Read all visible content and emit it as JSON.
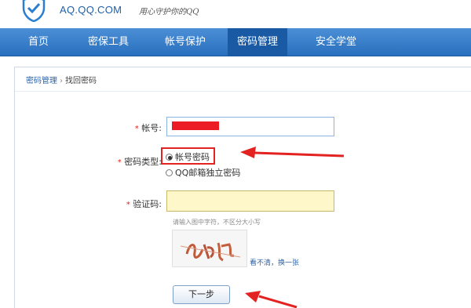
{
  "header": {
    "site_name": "AQ.QQ.COM",
    "slogan": "用心守护你的QQ"
  },
  "nav": {
    "items": [
      "首页",
      "密保工具",
      "帐号保护",
      "密码管理",
      "安全学堂"
    ],
    "active_index": 3
  },
  "breadcrumb": {
    "parent": "密码管理",
    "separator": "›",
    "current": "找回密码"
  },
  "form": {
    "account": {
      "required_mark": "*",
      "label": "帐号:"
    },
    "password_type": {
      "required_mark": "*",
      "label": "密码类型:",
      "options": [
        "帐号密码",
        "QQ邮箱独立密码"
      ],
      "selected_index": 0
    },
    "captcha": {
      "required_mark": "*",
      "label": "验证码:",
      "hint": "请输入图中字符，不区分大小写",
      "refresh_label": "看不清，换一张"
    },
    "next_button_label": "下一步"
  },
  "colors": {
    "nav_bg": "#2a6fbd",
    "annotation_red": "#e32321",
    "captcha_input_bg": "#fdf7c9",
    "link_blue": "#2a62a8"
  },
  "icons": [
    "shield-logo-icon",
    "annotation-arrow"
  ]
}
